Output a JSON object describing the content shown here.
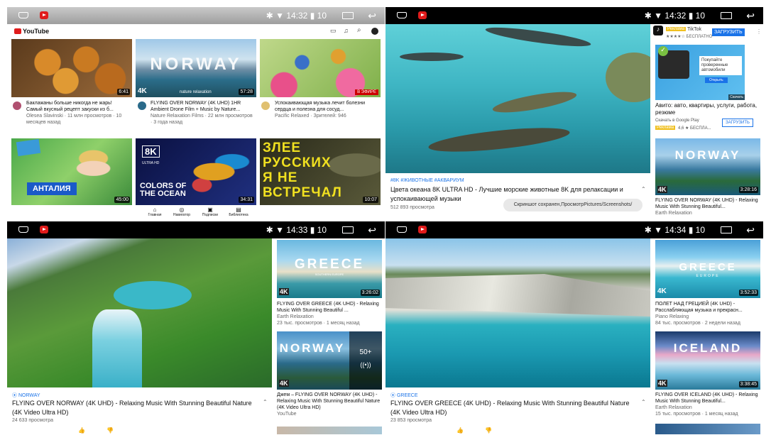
{
  "status": {
    "p1_time": "14:32",
    "p2_time": "14:32",
    "p3_time": "14:33",
    "p4_time": "14:34",
    "battery": "10"
  },
  "home": {
    "logo": "YouTube",
    "feed": [
      {
        "dur": "6:41",
        "title": "Баклажаны больше никогда не жарь! Самый вкусный рецепт закуски из б...",
        "sub": "Olesea Slavinski · 11 млн просмотров · 10 месяцев назад"
      },
      {
        "badge": "4K",
        "overlay": "NORWAY",
        "channel_tag": "nature relaxation",
        "dur": "57:28",
        "title": "FLYING OVER NORWAY (4K UHD) 1HR Ambient Drone Film + Music by Nature...",
        "sub": "Nature Relaxation Films · 22 млн просмотров · 3 года назад"
      },
      {
        "live": "В ЭФИРЕ",
        "title": "Успокаивающая музыка лечит болезни сердца и полезна для сосуд...",
        "sub": "Pacific Relaxed · Зрителей: 946"
      },
      {
        "overlay": "АНТАЛИЯ",
        "dur": "45:00"
      },
      {
        "overlay": "8K",
        "overlay2": "ULTRA HD",
        "overlay3": "COLORS OF THE OCEAN",
        "dur": "34:31"
      },
      {
        "overlay": "ЗЛЕЕ РУССКИХ Я НЕ ВСТРЕЧАЛ",
        "dur": "10:07"
      }
    ],
    "nav": [
      "Главная",
      "Навигатор",
      "Подписки",
      "Библиотека"
    ]
  },
  "ocean": {
    "tags": "#8K #ЖИВОТНЫЕ #АКВАРИУМ",
    "title": "Цвета океана 8K ULTRA HD - Лучшие морские животные 8K для релаксации и успокаивающей музыки",
    "views": "512 893 просмотра",
    "toast": "Скриншот сохранен,ПросмотрPictures/Screenshots/",
    "ad": {
      "badge": "Реклама",
      "app": "TikTok",
      "rating": "★★★★☆ БЕСПЛАТНО",
      "install": "ЗАГРУЗИТЬ"
    },
    "ad2": {
      "text": "Покупайте проверенные автомобили",
      "btn": "Открыть",
      "dl": "Скачать",
      "title": "Авито: авто, квартиры, услуги, работа, резюме",
      "store": "Скачать в Google Play",
      "badge": "Реклама",
      "rating": "4,6 ★ БЕСПЛА...",
      "install": "ЗАГРУЗИТЬ"
    },
    "next": {
      "overlay": "NORWAY",
      "badge": "4K",
      "dur": "3:28:16",
      "title": "FLYING OVER NORWAY (4K UHD) - Relaxing Music With Stunning Beautiful...",
      "channel": "Earth Relaxation"
    }
  },
  "norway": {
    "tag": "NORWAY",
    "title": "FLYING OVER NORWAY (4K UHD) - Relaxing Music With Stunning Beautiful Nature (4K Video Ultra HD)",
    "views": "24 633 просмотра",
    "side": [
      {
        "overlay": "GREECE",
        "overlay_sub": "SOUTHERN EUROPE",
        "badge": "4K",
        "dur": "3:26:02",
        "title": "FLYING OVER GREECE (4K UHD) - Relaxing Music With Stunning Beautiful ...",
        "channel": "Earth Relaxation",
        "sub": "23 тыс. просмотров · 1 месяц назад"
      },
      {
        "overlay": "NORWAY",
        "badge": "4K",
        "count": "50+",
        "title": "Джем – FLYING OVER NORWAY (4K UHD) - Relaxing Music With Stunning Beautiful Nature (4K Video Ultra HD)",
        "channel": "YouTube"
      }
    ]
  },
  "greece": {
    "tag": "GREECE",
    "title": "FLYING OVER GREECE (4K UHD) - Relaxing Music With Stunning Beautiful Nature (4K Video Ultra HD)",
    "views": "23 853 просмотра",
    "side": [
      {
        "overlay": "GREECE",
        "overlay_sub": "EUROPE",
        "badge": "4K",
        "dur": "3:52:33",
        "title": "ПОЛЕТ НАД ГРЕЦИЕЙ (4K UHD) - Расслабляющая музыка и прекрасн...",
        "channel": "Piano Relaxing",
        "sub": "84 тыс. просмотров · 2 недели назад"
      },
      {
        "overlay": "ICELAND",
        "badge": "4K",
        "dur": "3:38:45",
        "title": "FLYING OVER ICELAND (4K UHD) - Relaxing Music With Stunning Beautiful...",
        "channel": "Earth Relaxation",
        "sub": "15 тыс. просмотров · 1 месяц назад"
      }
    ]
  }
}
